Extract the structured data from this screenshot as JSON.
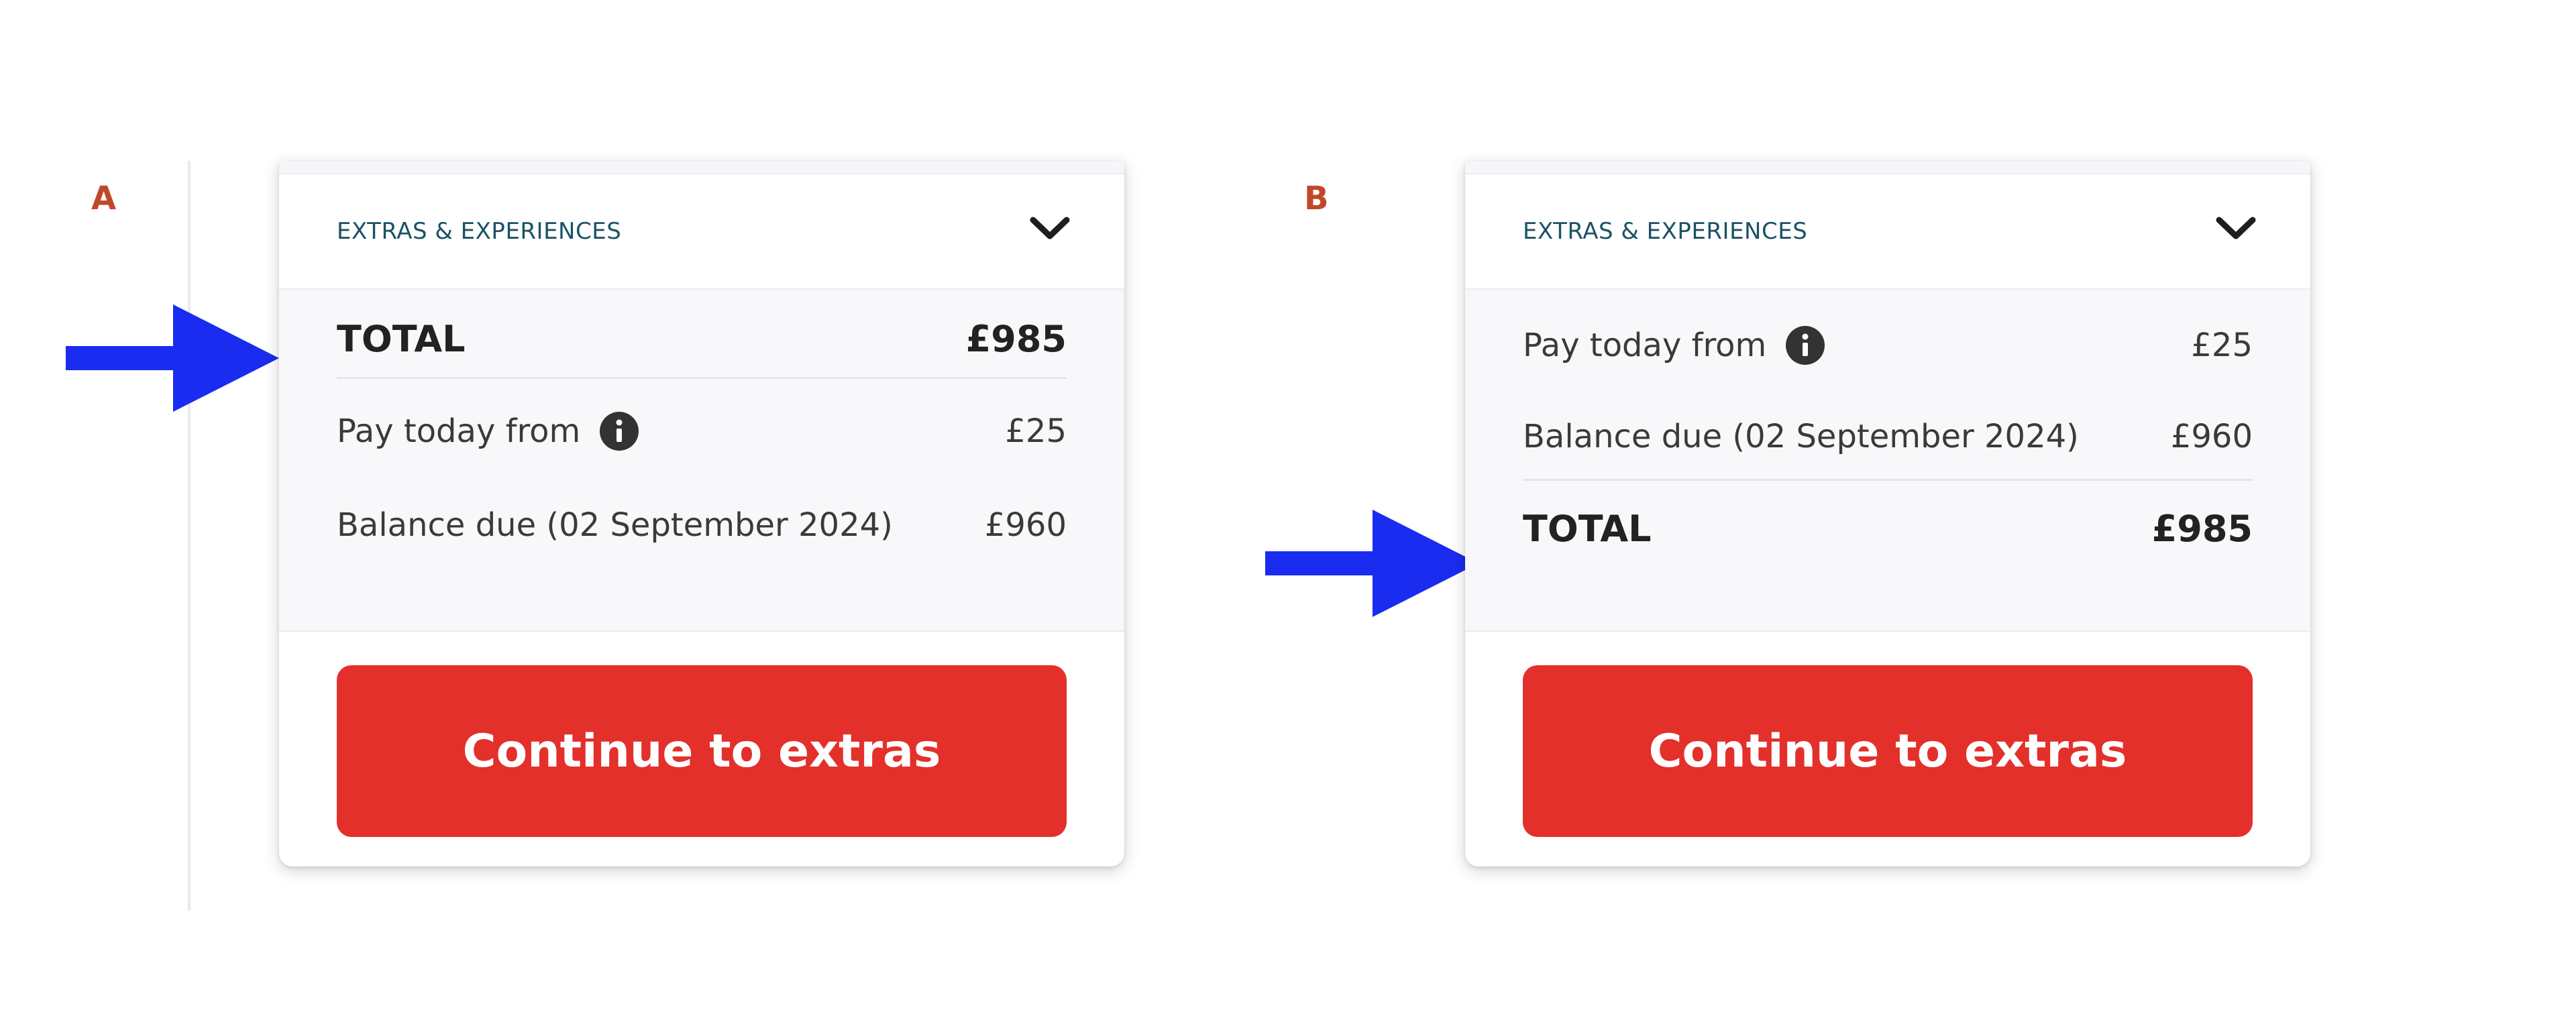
{
  "variants": [
    {
      "label": "A",
      "extras_title": "EXTRAS & EXPERIENCES",
      "total": {
        "label": "TOTAL",
        "value": "£985"
      },
      "pay_today": {
        "label": "Pay today from",
        "value": "£25"
      },
      "balance": {
        "label": "Balance due (02 September 2024)",
        "value": "£960"
      },
      "cta_label": "Continue to extras"
    },
    {
      "label": "B",
      "extras_title": "EXTRAS & EXPERIENCES",
      "pay_today": {
        "label": "Pay today from",
        "value": "£25"
      },
      "balance": {
        "label": "Balance due (02 September 2024)",
        "value": "£960"
      },
      "total": {
        "label": "TOTAL",
        "value": "£985"
      },
      "cta_label": "Continue to extras"
    }
  ],
  "icons": {
    "info": "info-circle-icon",
    "chevron": "chevron-down-icon",
    "pointer": "arrow-right-icon"
  },
  "colors": {
    "cta": "#e3302b",
    "variant_label": "#c0482a",
    "arrow": "#1a2cf0",
    "extras_title": "#1b5265"
  }
}
